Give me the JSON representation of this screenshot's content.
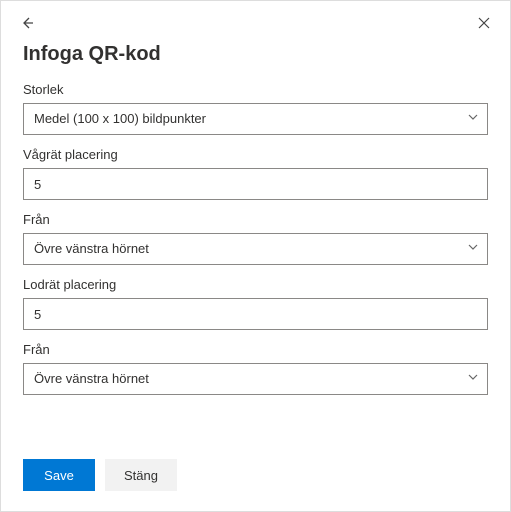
{
  "title": "Infoga QR-kod",
  "fields": {
    "size": {
      "label": "Storlek",
      "value": "Medel (100 x 100) bildpunkter"
    },
    "hpos": {
      "label": "Vågrät placering",
      "value": "5"
    },
    "hfrom": {
      "label": "Från",
      "value": "Övre vänstra hörnet"
    },
    "vpos": {
      "label": "Lodrät placering",
      "value": "5"
    },
    "vfrom": {
      "label": "Från",
      "value": "Övre vänstra hörnet"
    }
  },
  "buttons": {
    "save": "Save",
    "close": "Stäng"
  }
}
